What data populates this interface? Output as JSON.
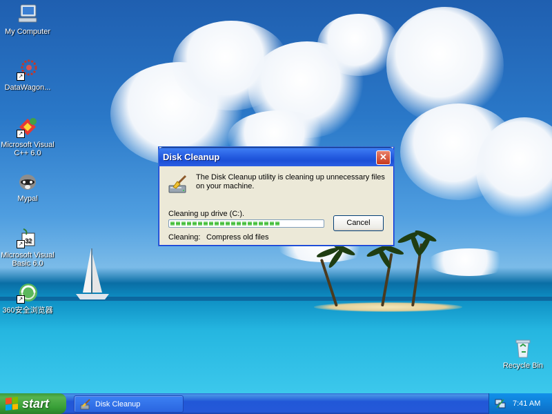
{
  "desktop": {
    "icons": [
      {
        "label": "My Computer",
        "icon": "my-computer-icon",
        "shortcut": false
      },
      {
        "label": "DataWagon...",
        "icon": "datawagon-icon",
        "shortcut": true
      },
      {
        "label": "Microsoft Visual C++ 6.0",
        "icon": "visual-cpp-icon",
        "shortcut": true
      },
      {
        "label": "Mypal",
        "icon": "mypal-icon",
        "shortcut": false
      },
      {
        "label": "Microsoft Visual Basic 6.0",
        "icon": "visual-basic-icon",
        "shortcut": true
      },
      {
        "label": "360安全浏览器",
        "icon": "360-browser-icon",
        "shortcut": true
      },
      {
        "label": "Recycle Bin",
        "icon": "recycle-bin-icon",
        "shortcut": false
      }
    ]
  },
  "dialog": {
    "title": "Disk Cleanup",
    "close_symbol": "✕",
    "message": "The Disk Cleanup utility is cleaning up unnecessary files on your machine.",
    "drive_label": "Cleaning up drive  (C:).",
    "progress_percent": 76,
    "cancel_label": "Cancel",
    "cleaning_label": "Cleaning:",
    "cleaning_item": "Compress old files"
  },
  "taskbar": {
    "start_label": "start",
    "task_label": "Disk Cleanup",
    "clock": "7:41 AM"
  },
  "colors": {
    "titlebar": "#2a63e5",
    "start": "#379e36",
    "taskbar": "#2559d8",
    "progress": "#31b52a"
  }
}
